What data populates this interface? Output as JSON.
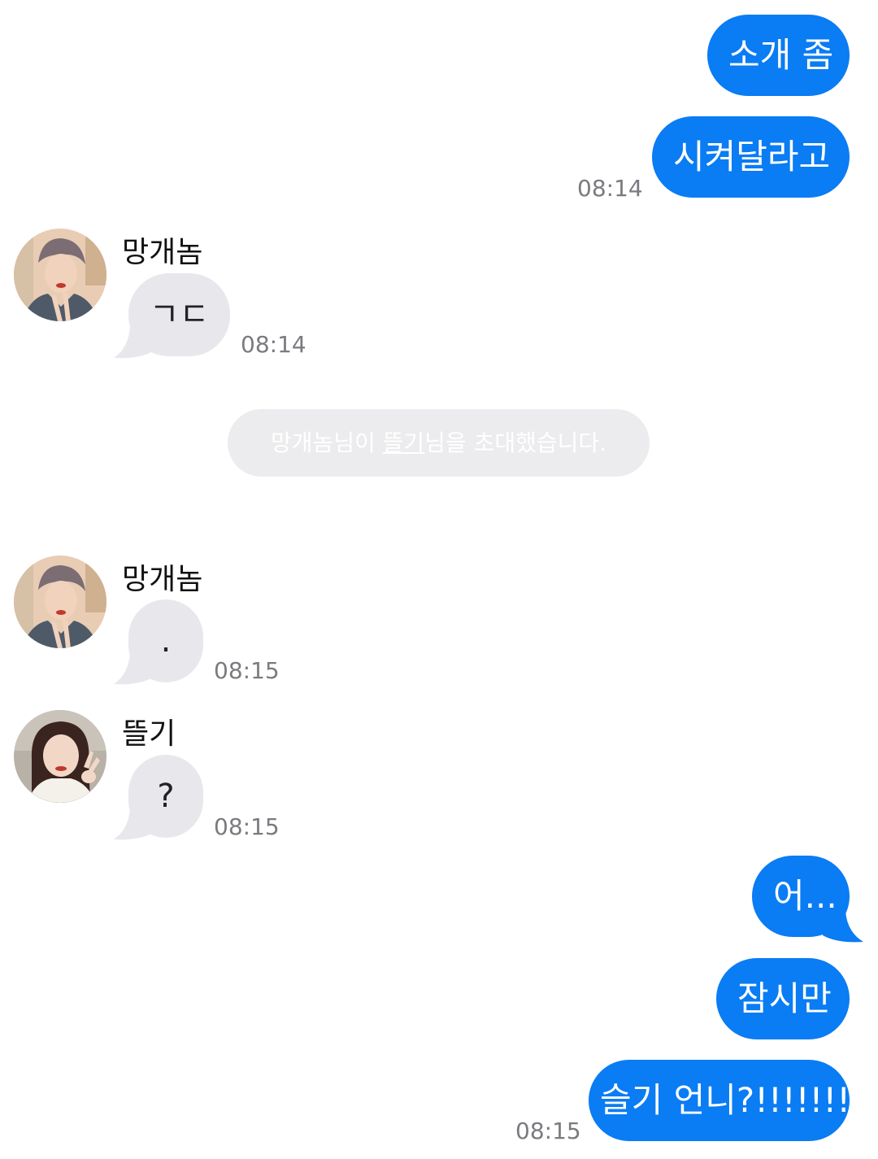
{
  "colors": {
    "outgoing_bubble": "#0a7cf4",
    "incoming_bubble": "#e8e8ec",
    "timestamp": "#7b7b7f",
    "system_pill": "#ececee"
  },
  "messages": {
    "out1": {
      "text": "소개 좀"
    },
    "out2": {
      "text": "시켜달라고",
      "time": "08:14"
    },
    "in1": {
      "sender": "망개놈",
      "text": "ㄱㄷ",
      "time": "08:14",
      "avatar": "avatar-man"
    },
    "system": {
      "part1": "망개놈님이 ",
      "link": "뜰기",
      "part2": "님을 초대했습니다."
    },
    "in2": {
      "sender": "망개놈",
      "text": ".",
      "time": "08:15",
      "avatar": "avatar-man"
    },
    "in3": {
      "sender": "뜰기",
      "text": "?",
      "time": "08:15",
      "avatar": "avatar-woman"
    },
    "out3": {
      "text": "어..."
    },
    "out4": {
      "text": "잠시만"
    },
    "out5": {
      "text": "슬기 언니?!!!!!!!",
      "time": "08:15"
    }
  }
}
